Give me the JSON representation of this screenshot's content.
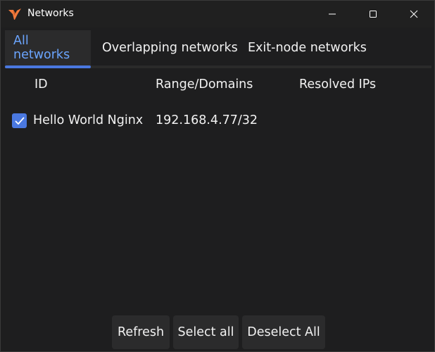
{
  "window": {
    "title": "Networks",
    "app_icon": "netbird-bird-icon",
    "controls": [
      "minimize-icon",
      "maximize-icon",
      "close-icon"
    ]
  },
  "tabs": [
    {
      "label": "All networks",
      "active": true
    },
    {
      "label": "Overlapping networks",
      "active": false
    },
    {
      "label": "Exit-node networks",
      "active": false
    }
  ],
  "table": {
    "columns": [
      "ID",
      "Range/Domains",
      "Resolved IPs"
    ],
    "rows": [
      {
        "checked": true,
        "id": "Hello World Nginx",
        "range": "192.168.4.77/32",
        "resolved_ips": ""
      }
    ]
  },
  "buttons": {
    "refresh": "Refresh",
    "select_all": "Select all",
    "deselect_all": "Deselect All"
  },
  "colors": {
    "accent": "#4a78e0",
    "active_tab_text": "#6ba5ff",
    "background": "#1e1e1f",
    "surface": "#2b2b2c",
    "logo": "#f07a3c"
  }
}
